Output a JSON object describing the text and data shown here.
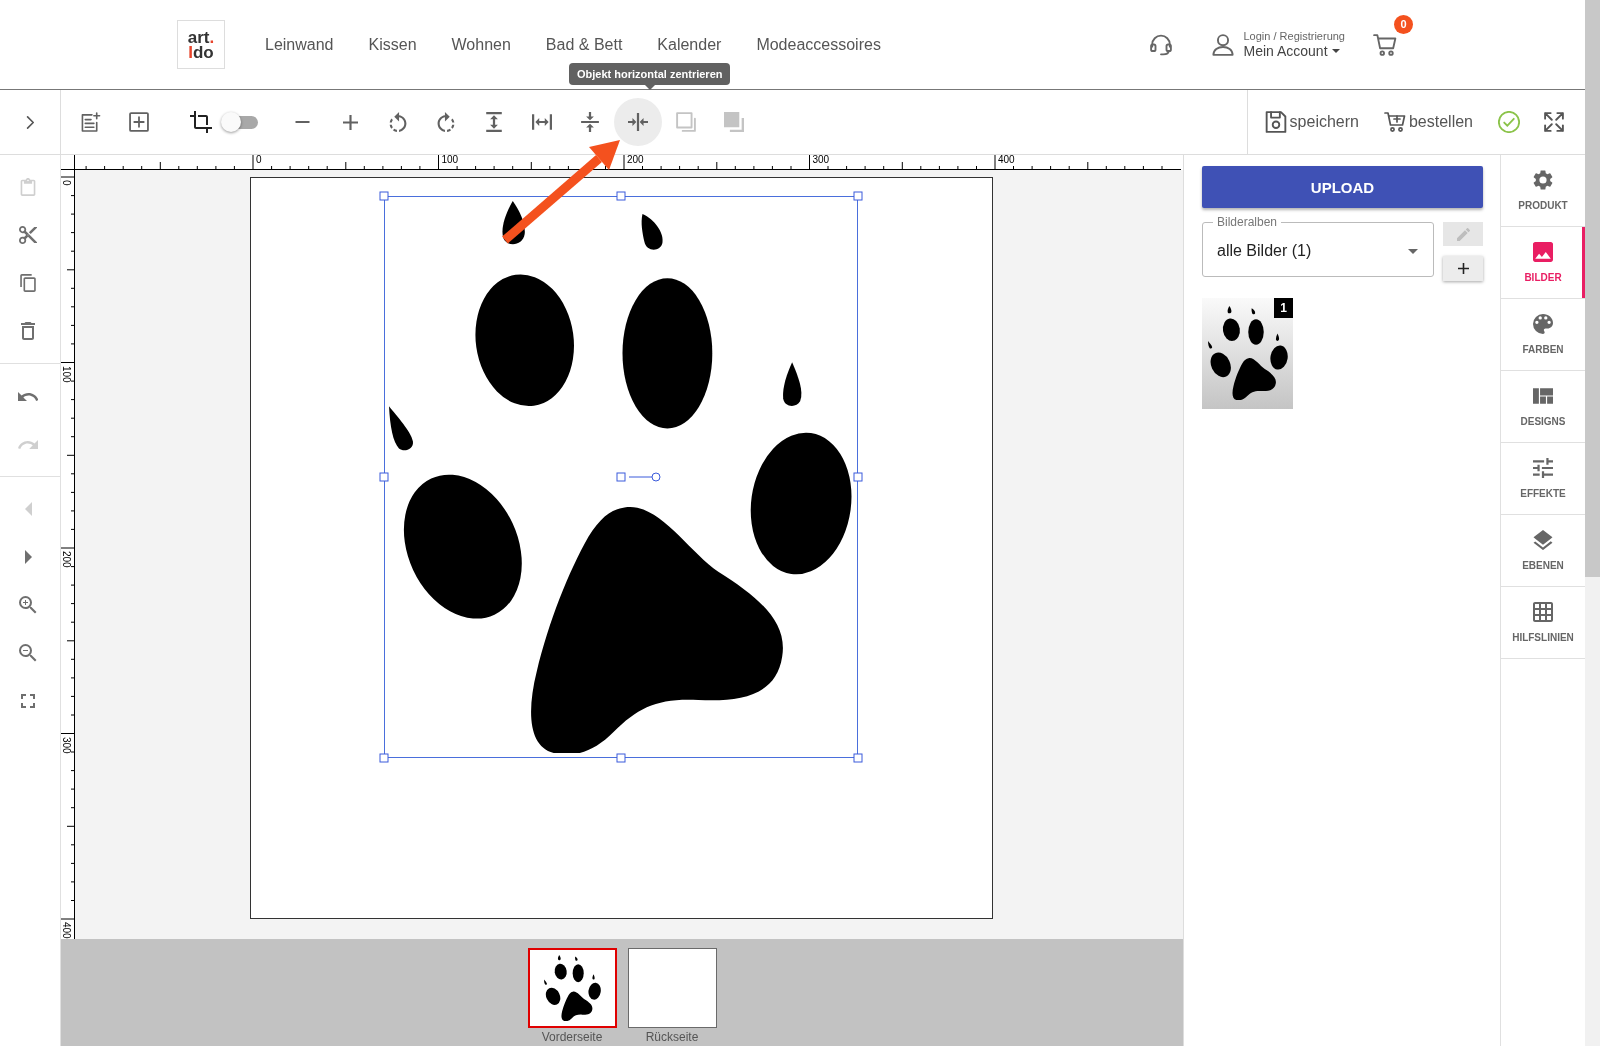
{
  "header": {
    "logo": [
      [
        {
          "text": "art",
          "color": "#333333"
        },
        {
          "text": ".",
          "color": "#e8452c"
        }
      ],
      [
        {
          "text": "I",
          "color": "#e8452c"
        },
        {
          "text": "do",
          "color": "#333333"
        }
      ]
    ],
    "nav": [
      "Leinwand",
      "Kissen",
      "Wohnen",
      "Bad & Bett",
      "Kalender",
      "Modeaccessoires"
    ],
    "login": "Login / Registrierung",
    "account": "Mein Account",
    "cart_badge": "0"
  },
  "tooltip": "Objekt horizontal zentrieren",
  "toolbar": {
    "tools": [
      {
        "kind": "button",
        "disabled": false,
        "hovered": false
      },
      {
        "kind": "button",
        "disabled": false,
        "hovered": false
      },
      {
        "kind": "button",
        "disabled": false,
        "hovered": false
      },
      {
        "kind": "switch",
        "on": false
      },
      {
        "kind": "button",
        "disabled": false,
        "hovered": false
      },
      {
        "kind": "button",
        "disabled": false,
        "hovered": false
      },
      {
        "kind": "button",
        "disabled": false,
        "hovered": false
      },
      {
        "kind": "button",
        "disabled": false,
        "hovered": false
      },
      {
        "kind": "button",
        "disabled": false,
        "hovered": false
      },
      {
        "kind": "button",
        "disabled": false,
        "hovered": false
      },
      {
        "kind": "button",
        "disabled": false,
        "hovered": false
      },
      {
        "kind": "button",
        "disabled": false,
        "hovered": true
      },
      {
        "kind": "button",
        "disabled": true,
        "hovered": false
      },
      {
        "kind": "button",
        "disabled": true,
        "hovered": false
      }
    ],
    "actions": [
      "speichern",
      "bestellen"
    ]
  },
  "edit_tools": [
    {
      "tools": [
        {
          "disabled": true
        },
        {
          "disabled": false
        },
        {
          "disabled": false
        },
        {
          "disabled": false
        }
      ]
    },
    {
      "tools": [
        {
          "disabled": false
        },
        {
          "disabled": true
        }
      ]
    },
    {
      "tools": [
        {
          "disabled": true
        },
        {
          "disabled": false
        },
        {
          "disabled": false
        },
        {
          "disabled": false
        },
        {
          "disabled": false
        }
      ]
    }
  ],
  "rulers": {
    "horizontal": [
      "0",
      "100",
      "200",
      "300",
      "400"
    ],
    "vertical": [
      "0",
      "100",
      "200",
      "300",
      "400"
    ]
  },
  "canvas": {
    "object": {
      "selected": true
    }
  },
  "pages": [
    {
      "label": "Vorderseite",
      "selected": true,
      "kind": "image"
    },
    {
      "label": "Rückseite",
      "selected": false,
      "kind": "empty"
    }
  ],
  "panel": {
    "upload": "UPLOAD",
    "album": {
      "label": "Bilderalben",
      "value": "alle Bilder (1)"
    },
    "edit": {
      "disabled": true
    },
    "images": [
      {
        "badge": "1"
      }
    ]
  },
  "side_tabs": [
    {
      "label": "PRODUKT",
      "selected": false
    },
    {
      "label": "BILDER",
      "selected": true
    },
    {
      "label": "FARBEN",
      "selected": false
    },
    {
      "label": "DESIGNS",
      "selected": false
    },
    {
      "label": "EFFEKTE",
      "selected": false
    },
    {
      "label": "EBENEN",
      "selected": false
    },
    {
      "label": "HILFSLINIEN",
      "selected": false
    }
  ]
}
